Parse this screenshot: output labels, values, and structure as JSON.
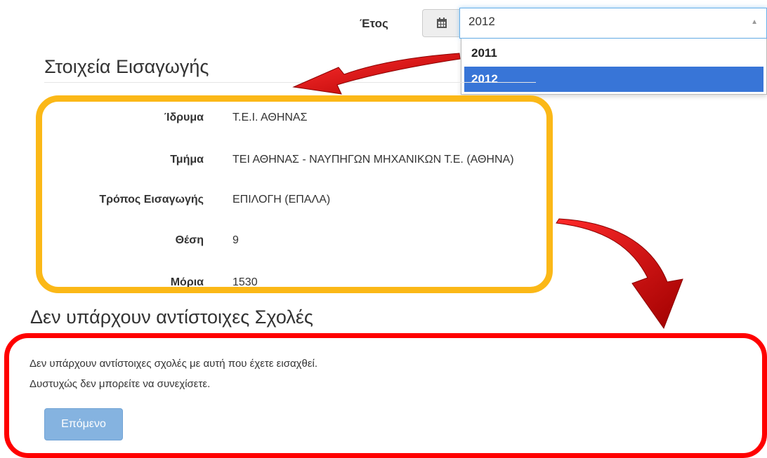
{
  "year_select": {
    "label": "Έτος",
    "value": "2012",
    "options": [
      "2011",
      "2012"
    ],
    "selected_index": 1
  },
  "admission": {
    "heading": "Στοιχεία Εισαγωγής",
    "fields": [
      {
        "label": "Ίδρυμα",
        "value": "Τ.Ε.Ι. ΑΘΗΝΑΣ"
      },
      {
        "label": "Τμήμα",
        "value": "ΤΕΙ ΑΘΗΝΑΣ - ΝΑΥΠΗΓΩΝ ΜΗΧΑΝΙΚΩΝ Τ.Ε. (ΑΘΗΝΑ)"
      },
      {
        "label": "Τρόπος Εισαγωγής",
        "value": "ΕΠΙΛΟΓΗ (ΕΠΑΛΑ)"
      },
      {
        "label": "Θέση",
        "value": "9"
      },
      {
        "label": "Μόρια",
        "value": "1530"
      }
    ]
  },
  "no_match": {
    "heading": "Δεν υπάρχουν αντίστοιχες Σχολές",
    "message_1": "Δεν υπάρχουν αντίστοιχες σχολές με αυτή που έχετε εισαχθεί.",
    "message_2": "Δυστυχώς δεν μπορείτε να συνεχίσετε.",
    "next_label": "Επόμενο"
  },
  "colors": {
    "highlight_orange": "#fbb817",
    "highlight_red": "#ff0000",
    "arrow_red": "#d40000",
    "selected_option": "#3875d7",
    "button": "#7fafdf"
  },
  "icons": [
    "calendar-icon",
    "chevron-up-icon",
    "arrow-annotation"
  ]
}
